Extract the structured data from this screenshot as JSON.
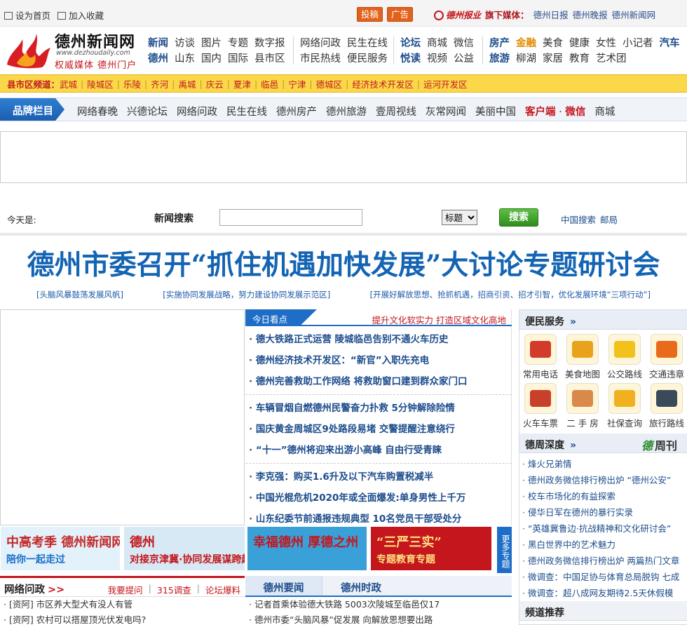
{
  "topbar": {
    "set_home": "设为首页",
    "add_fav": "加入收藏",
    "contribute": "投稿",
    "ads": "广告",
    "group_logo": "德州报业",
    "media_label": "旗下媒体：",
    "media": [
      "德州日报",
      "德州晚报",
      "德州新闻网"
    ]
  },
  "logo": {
    "name": "德州新闻网",
    "url": "www.dezhoudaily.com",
    "slogan": "权威媒体 德州门户"
  },
  "nav": {
    "block1": [
      [
        "新闻",
        "访谈",
        "图片",
        "专题",
        "数字报"
      ],
      [
        "德州",
        "山东",
        "国内",
        "国际",
        "县市区"
      ]
    ],
    "block2": [
      [
        "网络问政",
        "民生在线"
      ],
      [
        "市民热线",
        "便民服务"
      ]
    ],
    "block3": [
      [
        "论坛",
        "商城",
        "微信"
      ],
      [
        "悦读",
        "视频",
        "公益"
      ]
    ],
    "block4": [
      [
        "房产",
        "金融",
        "美食",
        "健康",
        "女性",
        "小记者",
        "汽车"
      ],
      [
        "旅游",
        "柳湖",
        "家居",
        "教育",
        "艺术团"
      ]
    ]
  },
  "county": {
    "label": "县市区频道：",
    "items": [
      "武城",
      "陵城区",
      "乐陵",
      "齐河",
      "禹城",
      "庆云",
      "夏津",
      "临邑",
      "宁津",
      "德城区",
      "经济技术开发区",
      "运河开发区"
    ]
  },
  "brand": {
    "tag": "品牌栏目",
    "items": [
      "网络春晚",
      "兴德论坛",
      "网络问政",
      "民生在线",
      "德州房产",
      "德州旅游",
      "壹周视线",
      "灰常网闻",
      "美丽中国"
    ],
    "client": "客户端",
    "dot": "·",
    "wechat": "微信",
    "mall": "商城"
  },
  "search": {
    "today_label": "今天是:",
    "label": "新闻搜索",
    "query": "",
    "select_value": "标题",
    "button": "搜索",
    "links": [
      "中国搜索",
      "邮局"
    ]
  },
  "headline": {
    "title": "德州市委召开“抓住机遇加快发展”大讨论专题研讨会",
    "subs": [
      "[头脑风暴鼓荡发展风帆]",
      "[实施协同发展战略，努力建设协同发展示范区]",
      "[开展好解放思想、抢抓机遇，招商引资、招才引智，优化发展环境“三项行动”]"
    ]
  },
  "today": {
    "tab": "今日看点",
    "promo": "提升文化软实力 打造区域文化高地",
    "groups": [
      [
        "德大铁路正式运营 陵城临邑告别不通火车历史",
        "德州经济技术开发区：“新官”入职先充电",
        "德州完善救助工作网络 将救助窗口建到群众家门口"
      ],
      [
        "车辆冒烟自燃德州民警奋力扑救 5分钟解除险情",
        "国庆黄金周城区9处路段易堵 交警提醒注意绕行",
        "“十一”德州将迎来出游小高峰 自由行受青睐"
      ],
      [
        "李克强：购买1.6升及以下汽车购置税减半",
        "中国光棍危机2020年或全面爆发:单身男性上千万",
        "山东纪委节前通报违规典型 10名党员干部受处分"
      ]
    ]
  },
  "services": {
    "title": "便民服务",
    "arrow": "»",
    "items": [
      {
        "label": "常用电话",
        "icon": "telephone-icon",
        "color": "#d23a2a"
      },
      {
        "label": "美食地图",
        "icon": "food-icon",
        "color": "#e8a21c"
      },
      {
        "label": "公交路线",
        "icon": "bus-icon",
        "color": "#f2c21a"
      },
      {
        "label": "交通违章",
        "icon": "car-icon",
        "color": "#e86a1a"
      },
      {
        "label": "火车车票",
        "icon": "train-icon",
        "color": "#c8402a"
      },
      {
        "label": "二 手 房",
        "icon": "house-icon",
        "color": "#d98a4a"
      },
      {
        "label": "社保查询",
        "icon": "piggy-bank-icon",
        "color": "#f0b020"
      },
      {
        "label": "旅行路线",
        "icon": "backpack-icon",
        "color": "#3a4a5a"
      }
    ]
  },
  "zhoukan": {
    "title": "德周深度",
    "arrow": "»",
    "brand_glyph": "德",
    "brand_text": "周刊",
    "items": [
      "烽火兄弟情",
      "德州政务微信排行榜出炉 “德州公安”",
      "校车市场化的有益探索",
      "侵华日军在德州的暴行实录",
      "“英雄冀鲁边·抗战精神和文化研讨会”",
      "黑白世界中的艺术魅力",
      "德州政务微信排行榜出炉 两篇热门文章",
      "微调查：中国足协与体育总局脱钩 七成",
      "微调查：超八成网友期待2.5天休假模"
    ]
  },
  "channels": {
    "title": "频道推荐"
  },
  "banners": [
    {
      "t1": "中高考季 德州新闻网",
      "t2": "陪你一起走过",
      "bg": "#e3f1fb",
      "c1": "#c42a2a",
      "c2": "#1a6ec8"
    },
    {
      "t1": "德州",
      "t2": "对接京津冀·协同发展谋跨越",
      "bg": "#d6e9f5",
      "c1": "#c4161c",
      "c2": "#c4161c"
    },
    {
      "t1": "幸福德州 厚德之州",
      "t2": "",
      "bg": "#3aa0d8",
      "c1": "#c4161c",
      "c2": "#ffffff"
    },
    {
      "t1": "“三严三实”",
      "t2": "专题教育专题",
      "bg": "#c4161c",
      "c1": "#ffe080",
      "c2": "#ffe080"
    }
  ],
  "more_topics": "更多专题",
  "wenzheng": {
    "title": "网络问政",
    "arrow": ">>",
    "links": [
      "我要提问",
      "315调查",
      "论坛爆料"
    ],
    "items": [
      "[资阿] 市区养大型犬有没人有管",
      "[资阿] 农村可以搭屋顶光伏发电吗?"
    ]
  },
  "dezhou": {
    "tabs": [
      "德州要闻",
      "德州时政"
    ],
    "items": [
      "记者首乘体验德大铁路 5003次陵城至临邑仅17",
      "德州市委“头脑风暴”促发展 向解放思想要出路"
    ]
  }
}
